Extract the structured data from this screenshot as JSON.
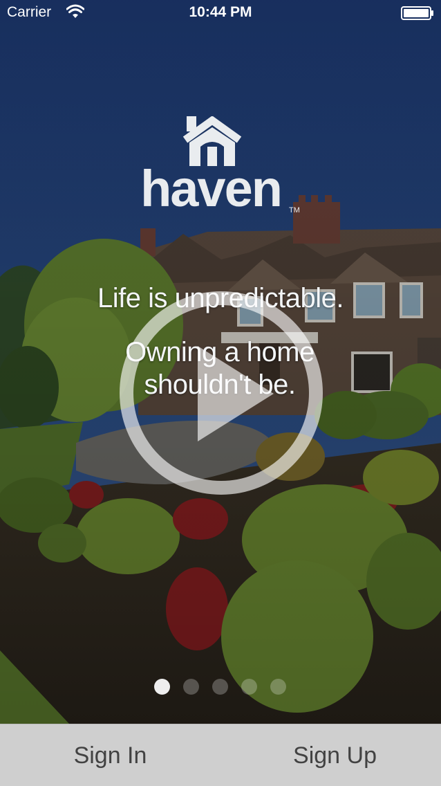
{
  "status_bar": {
    "carrier": "Carrier",
    "time": "10:44 PM",
    "wifi_icon": "wifi-icon",
    "battery_icon": "battery-icon"
  },
  "brand": {
    "logo_icon": "house-icon",
    "wordmark": "haven",
    "trademark": "TM"
  },
  "hero": {
    "headline": "Life is unpredictable.",
    "subline_1": "Owning a home",
    "subline_2": "shouldn't be.",
    "play_icon": "play-icon"
  },
  "pager": {
    "count": 5,
    "active_index": 0
  },
  "actions": {
    "sign_in": "Sign In",
    "sign_up": "Sign Up"
  },
  "colors": {
    "sky": "#1d3a6e",
    "action_bar": "#cfcfcf",
    "action_text": "#424242",
    "text_light": "#f3f5f7"
  }
}
